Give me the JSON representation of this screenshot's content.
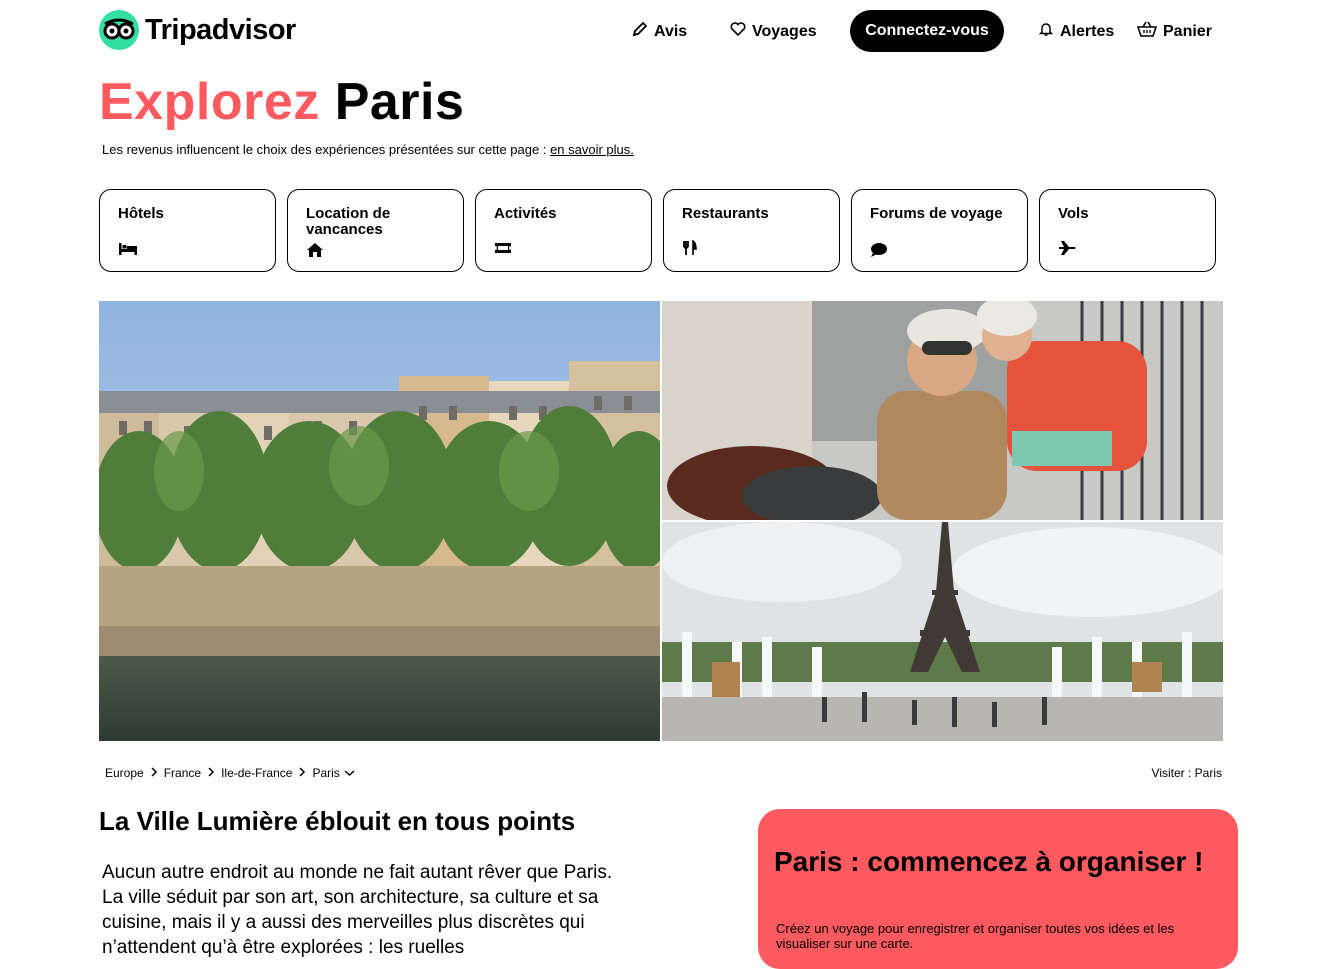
{
  "header": {
    "logo_text": "Tripadvisor",
    "nav": {
      "avis": "Avis",
      "voyages": "Voyages",
      "connect": "Connectez-vous",
      "alertes": "Alertes",
      "panier": "Panier"
    }
  },
  "hero": {
    "title_accent": "Explorez",
    "title_rest": "Paris",
    "disclaimer": "Les revenus influencent le choix des expériences présentées sur cette page :",
    "disclaimer_link": "en savoir plus."
  },
  "categories": [
    {
      "label": "Hôtels",
      "icon": "bed-icon"
    },
    {
      "label": "Location de vancances",
      "icon": "house-icon"
    },
    {
      "label": "Activités",
      "icon": "ticket-icon"
    },
    {
      "label": "Restaurants",
      "icon": "fork-knife-icon"
    },
    {
      "label": "Forums de voyage",
      "icon": "chat-bubble-icon"
    },
    {
      "label": "Vols",
      "icon": "plane-icon"
    }
  ],
  "breadcrumb": [
    "Europe",
    "France",
    "Ile-de-France",
    "Paris"
  ],
  "visit_label": "Visiter : Paris",
  "section": {
    "title": "La Ville Lumière éblouit en tous points",
    "body": "Aucun autre endroit au monde ne fait autant rêver que Paris. La ville séduit par son art, son architecture, sa culture et sa cuisine, mais il y a aussi des merveilles plus discrètes qui n’attendent qu’à être explorées : les ruelles"
  },
  "plan_card": {
    "title": "Paris : commencez à organiser !",
    "text": "Créez un voyage pour enregistrer et organiser toutes vos idées et les visualiser sur une carte."
  },
  "colors": {
    "accent": "#ff5a5f",
    "logo_green": "#34e0a1",
    "button_black": "#000000"
  }
}
